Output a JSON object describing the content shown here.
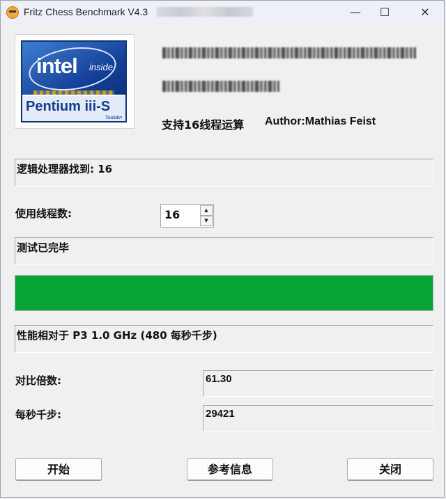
{
  "window": {
    "title": "Fritz Chess Benchmark V4.3",
    "controls": {
      "minimize": "—",
      "maximize": "☐",
      "close": "✕"
    }
  },
  "logo": {
    "brand": "intel",
    "tagline": "inside",
    "product": "Pentium iii-S",
    "sub": "Tualatin"
  },
  "header": {
    "threads_info": "支持16线程运算",
    "author": "Author:Mathias Feist"
  },
  "status": {
    "processors_found": "逻辑处理器找到: 16",
    "thread_count_label": "使用线程数:",
    "thread_count_value": "16",
    "test_status": "测试已完毕",
    "performance_note": "性能相对于 P3 1.0 GHz (480 每秒千步)"
  },
  "progress": {
    "value_percent": 100,
    "color": "#08a435"
  },
  "results": {
    "ratio_label": "对比倍数:",
    "ratio_value": "61.30",
    "kps_label": "每秒千步:",
    "kps_value": "29421"
  },
  "buttons": {
    "start": "开始",
    "info": "参考信息",
    "close": "关闭"
  }
}
